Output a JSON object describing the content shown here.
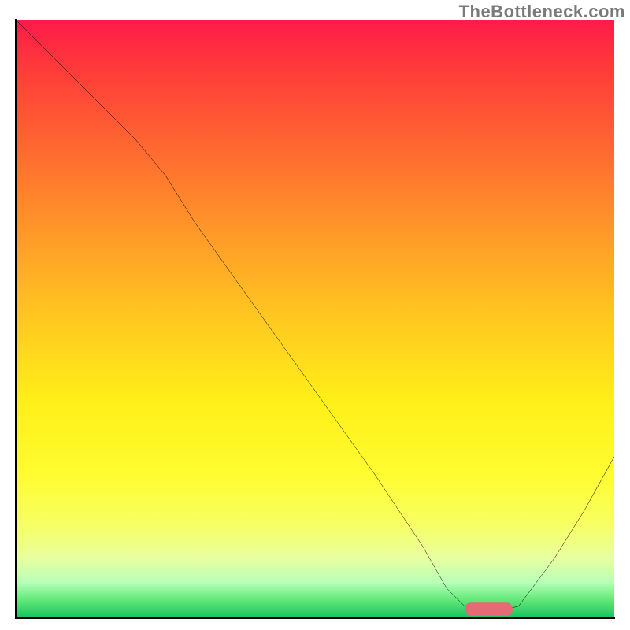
{
  "watermark": "TheBottleneck.com",
  "colors": {
    "gradient_top": "#ff1a4a",
    "gradient_mid1": "#ff9a28",
    "gradient_mid2": "#fff018",
    "gradient_bottom": "#18c060",
    "curve": "#000000",
    "marker": "#e46a76",
    "axes": "#000000"
  },
  "chart_data": {
    "type": "line",
    "title": "",
    "xlabel": "",
    "ylabel": "",
    "xlim": [
      0,
      100
    ],
    "ylim": [
      0,
      100
    ],
    "grid": false,
    "legend": false,
    "note": "Axes have no visible tick labels. Values below are estimated from pixel positions on a 0–100 normalized scale where (0,0) is bottom-left of the plot.",
    "series": [
      {
        "name": "bottleneck-curve",
        "x": [
          0,
          10,
          20,
          25,
          30,
          40,
          50,
          60,
          68,
          72,
          76,
          80,
          84,
          90,
          95,
          100
        ],
        "y": [
          100,
          90,
          80,
          74,
          66,
          52,
          38,
          24,
          12,
          5,
          1,
          1,
          2,
          10,
          18,
          27
        ]
      }
    ],
    "marker": {
      "name": "optimal-point",
      "shape": "rounded-bar",
      "x_center": 79,
      "y_center": 1.5,
      "width": 8,
      "height": 2.2
    },
    "background_gradient": {
      "direction": "vertical",
      "stops": [
        {
          "pos": 0.0,
          "color": "#ff1a4a"
        },
        {
          "pos": 0.22,
          "color": "#ff6a30"
        },
        {
          "pos": 0.5,
          "color": "#ffc820"
        },
        {
          "pos": 0.76,
          "color": "#fffc30"
        },
        {
          "pos": 0.94,
          "color": "#b8ffb8"
        },
        {
          "pos": 1.0,
          "color": "#18c060"
        }
      ]
    }
  }
}
